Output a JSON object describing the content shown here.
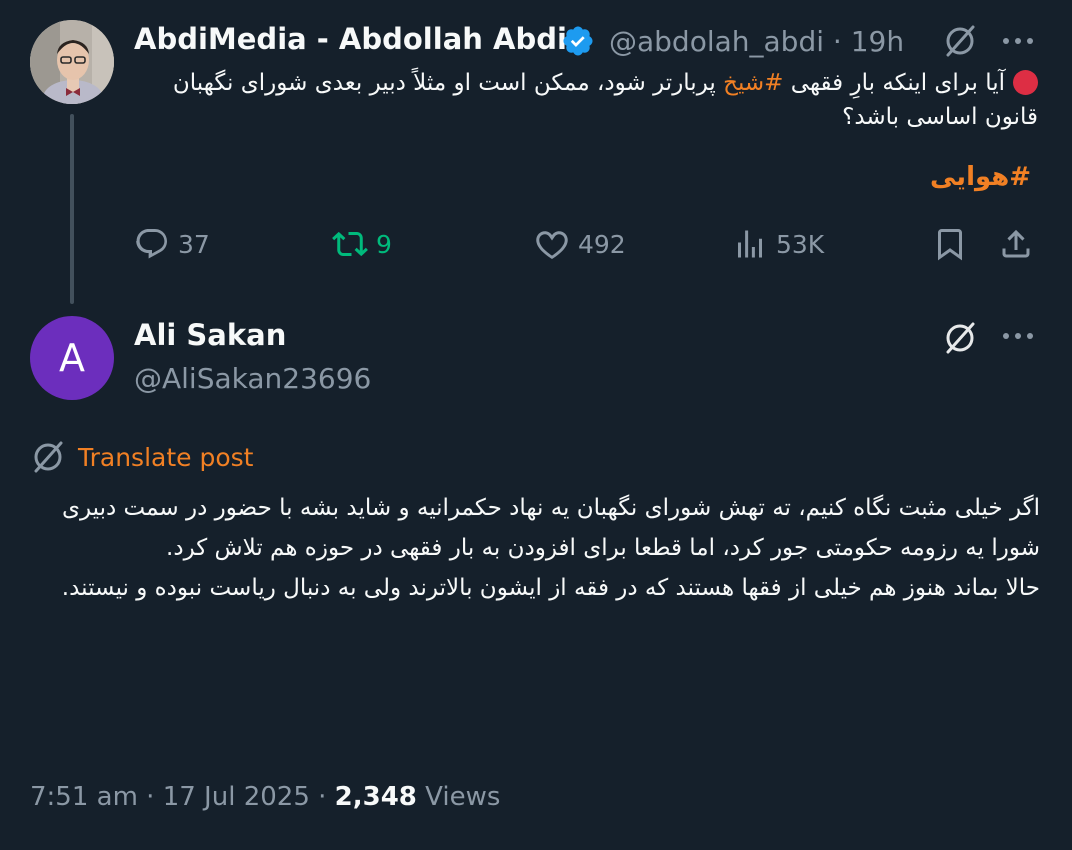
{
  "parent_tweet": {
    "author_name": "AbdiMedia - Abdollah Abdi",
    "handle": "@abdolah_abdi",
    "time": "· 19h",
    "text_before_tag": "آیا برای اینکه بارِ فقهی ",
    "hashtag1": "#شیخ",
    "text_after_tag": " پربارتر شود، ممکن است او مثلاً دبیر بعدی شورای نگهبان قانون اساسی باشد؟",
    "hashtag2": "#هوایی",
    "stats": {
      "replies": "37",
      "reposts": "9",
      "likes": "492",
      "views": "53K"
    },
    "icons": [
      "verified-badge-icon",
      "grok-icon",
      "more-icon",
      "reply-icon",
      "retweet-icon",
      "like-icon",
      "views-icon",
      "bookmark-icon",
      "share-icon"
    ]
  },
  "reply_tweet": {
    "avatar_letter": "A",
    "author_name": "Ali Sakan",
    "handle": "@AliSakan23696",
    "translate_label": "Translate post",
    "paragraphs": [
      "اگر خیلی مثبت نگاه کنیم، ته تهش شورای نگهبان یه نهاد حکمرانیه و شاید بشه با حضور در سمت دبیری شورا یه رزومه حکومتی جور کرد، اما قطعا برای افزودن به بار فقهی در حوزه هم تلاش کرد.",
      "حالا بماند هنوز هم خیلی از فقها هستند که در فقه از ایشون بالاترند ولی به دنبال ریاست نبوده و نیستند."
    ],
    "time": "7:51 am · 17 Jul 2025 · ",
    "views_count": "2,348",
    "views_label": " Views"
  },
  "colors": {
    "background": "#15202b",
    "text": "#f7f9f9",
    "muted": "#8b98a5",
    "hashtag": "#f18024",
    "retweet": "#00ba7c",
    "verified": "#1d9bf0",
    "avatar2": "#6c2ebd"
  }
}
